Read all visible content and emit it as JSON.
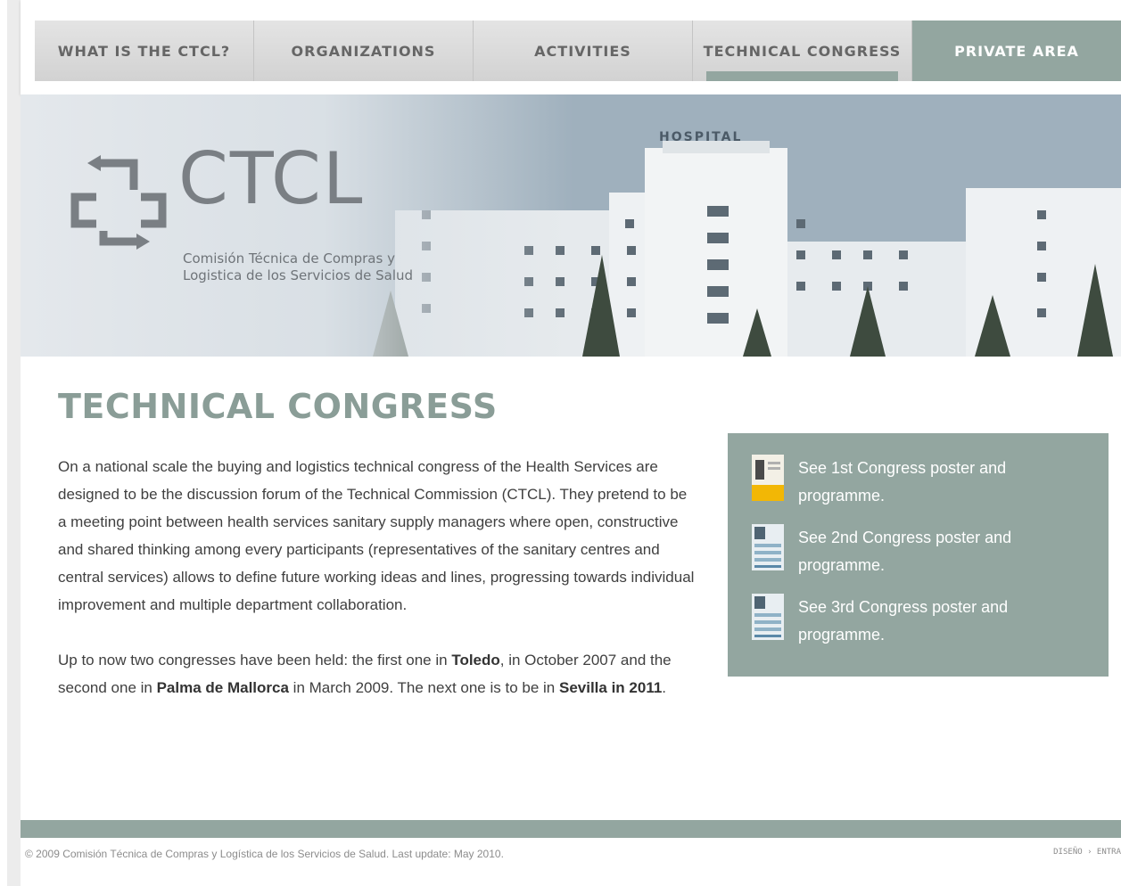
{
  "nav": {
    "items": [
      {
        "label": "WHAT IS THE CTCL?"
      },
      {
        "label": "ORGANIZATIONS"
      },
      {
        "label": "ACTIVITIES"
      },
      {
        "label": "TECHNICAL CONGRESS"
      },
      {
        "label": "PRIVATE AREA"
      }
    ],
    "active": "TECHNICAL CONGRESS"
  },
  "hero": {
    "logo_text": "CTCL",
    "logo_sub_line1": "Comisión Técnica de Compras y",
    "logo_sub_line2": "Logistica de los Servicios de Salud",
    "building_sign": "HOSPITAL"
  },
  "main": {
    "title": "TECHNICAL CONGRESS",
    "paragraph1": "On a national scale the buying and logistics technical congress of the Health Services are designed to be the discussion forum of the Technical Commission (CTCL). They pretend to be a meeting point between health services sanitary supply managers where open, constructive and shared thinking among every participants (representatives of the sanitary centres and central services) allows to define future working ideas and lines, progressing towards individual improvement and multiple department collaboration.",
    "p2_part1": "Up to now two congresses have been held: the first one in ",
    "p2_bold1": "Toledo",
    "p2_part2": ", in October 2007 and the second one in ",
    "p2_bold2": "Palma de Mallorca",
    "p2_part3": " in March 2009. The next one is to be in ",
    "p2_bold3": "Sevilla in 2011",
    "p2_part4": "."
  },
  "sidebar": {
    "links": [
      {
        "label": "See 1st Congress poster and programme."
      },
      {
        "label": "See 2nd Congress poster and programme."
      },
      {
        "label": "See 3rd Congress poster and programme."
      }
    ]
  },
  "footer": {
    "copyright": "© 2009 Comisión Técnica de Compras y Logística de los Servicios de Salud.   Last update: May 2010.",
    "credit": "DISEÑO › ENTRA"
  },
  "colors": {
    "accent": "#93a6a0",
    "title": "#8a9d97",
    "nav_text": "#666666"
  }
}
